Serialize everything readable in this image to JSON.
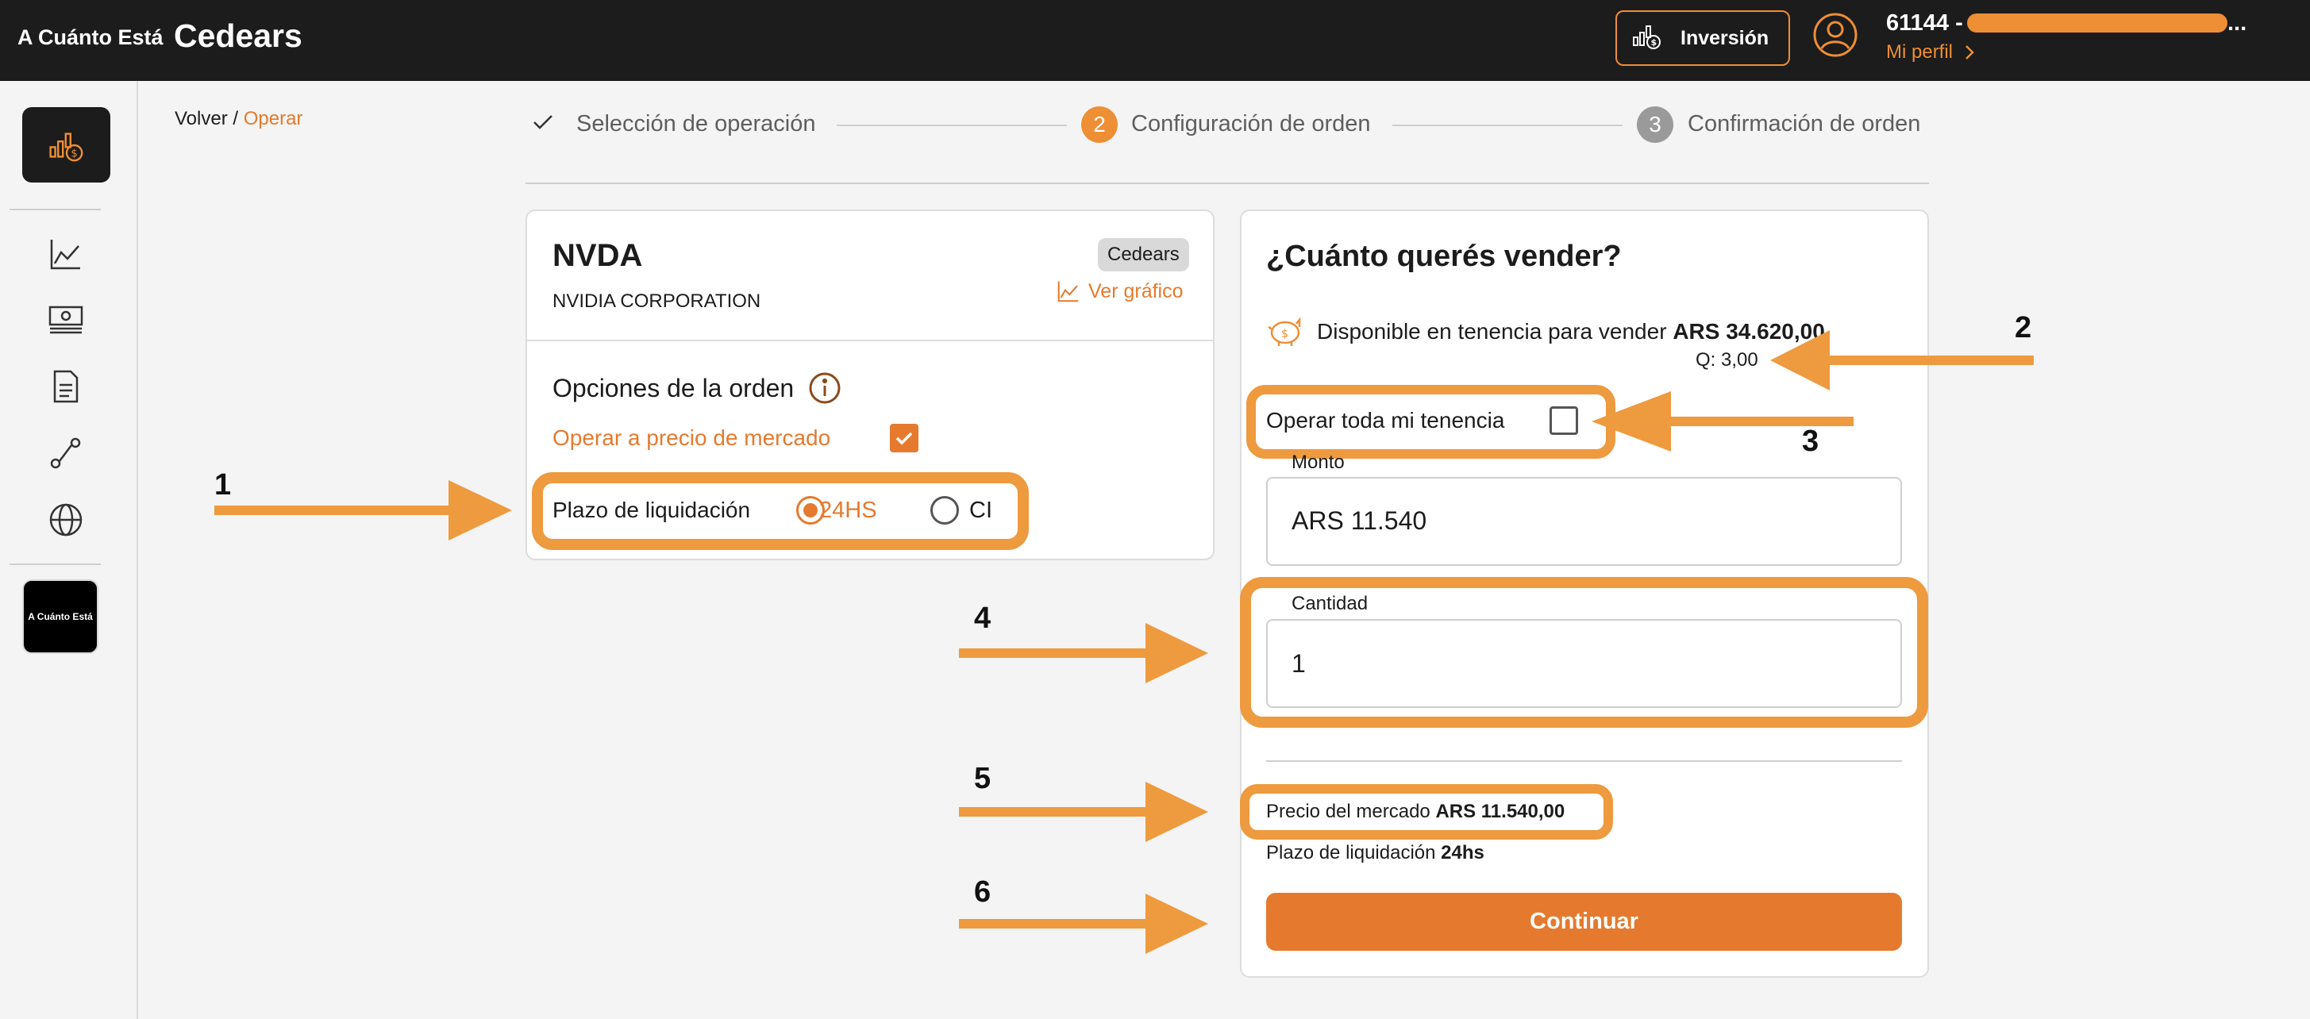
{
  "header": {
    "brand_small": "A Cuánto Está",
    "brand_big": "Cedears",
    "inversion_label": "Inversión",
    "account_number": "61144 -",
    "account_ellipsis": "...",
    "profile_link": "Mi perfil"
  },
  "sidebar": {
    "brand_logo_text": "A Cuánto Está",
    "icons": [
      "invest-icon",
      "chart-icon",
      "cash-icon",
      "document-icon",
      "route-icon",
      "globe-icon"
    ]
  },
  "breadcrumb": {
    "back": "Volver",
    "separator": " / ",
    "current": "Operar"
  },
  "stepper": {
    "step1": "Selección de operación",
    "step2_num": "2",
    "step2": "Configuración de orden",
    "step3_num": "3",
    "step3": "Confirmación de orden"
  },
  "asset": {
    "ticker": "NVDA",
    "company": "NVIDIA CORPORATION",
    "badge": "Cedears",
    "chart_link": "Ver gráfico"
  },
  "order_options": {
    "title": "Opciones de la orden",
    "market_price_label": "Operar a precio de mercado",
    "market_price_checked": true,
    "settlement_label": "Plazo de liquidación",
    "settlement_options": [
      "24HS",
      "CI"
    ],
    "settlement_selected": "24HS"
  },
  "sell": {
    "title": "¿Cuánto querés vender?",
    "available_prefix": "Disponible en tenencia para vender",
    "available_amount": "ARS 34.620,00",
    "quantity_held": "Q: 3,00",
    "operate_all_label": "Operar toda mi tenencia",
    "operate_all_checked": false,
    "monto_label": "Monto",
    "monto_value": "ARS 11.540",
    "cantidad_label": "Cantidad",
    "cantidad_value": "1",
    "market_price_prefix": "Precio del mercado",
    "market_price_value": "ARS 11.540,00",
    "settlement_prefix": "Plazo de liquidación",
    "settlement_value": "24hs",
    "continue_label": "Continuar"
  },
  "annotations": [
    "1",
    "2",
    "3",
    "4",
    "5",
    "6"
  ],
  "colors": {
    "accent": "#e57a2e",
    "highlight": "#ee9a3f",
    "topbar": "#1c1c1c"
  }
}
